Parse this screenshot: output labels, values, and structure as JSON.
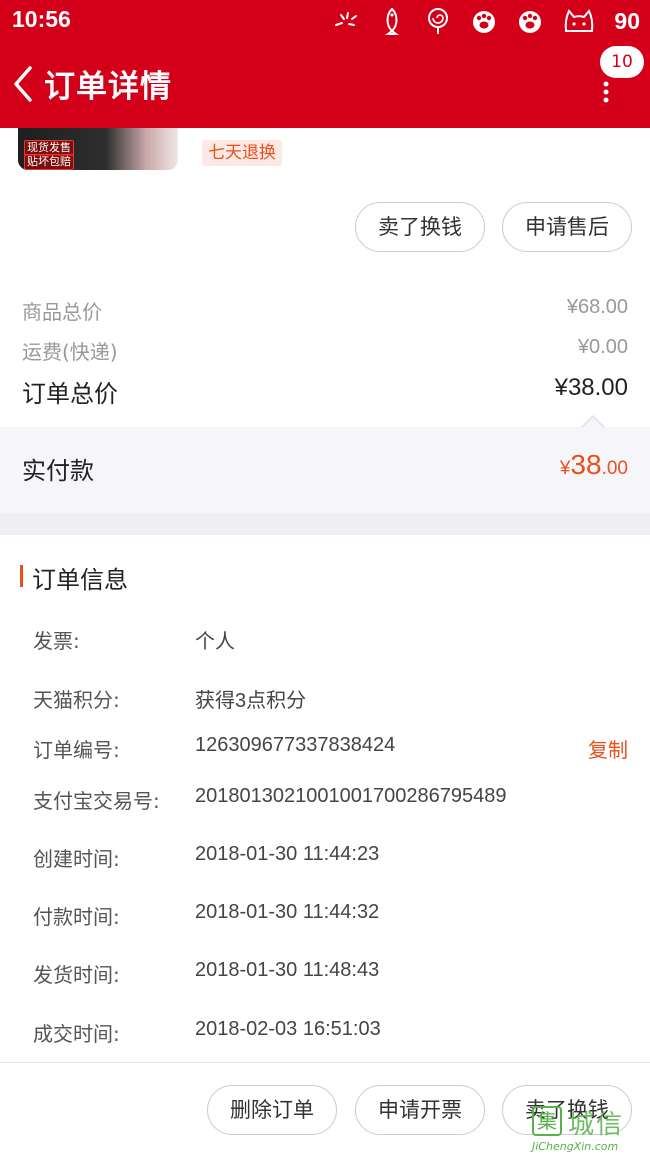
{
  "status_bar": {
    "time": "10:56",
    "battery": "90",
    "icons": [
      "notification-icon",
      "fish-icon",
      "lollipop-icon",
      "paw-icon",
      "paw-icon",
      "cat-icon"
    ]
  },
  "header": {
    "title": "订单详情",
    "badge_count": "10",
    "colors": {
      "brand": "#d4001a"
    }
  },
  "product": {
    "thumb_tags": [
      "现货发售",
      "贴坏包赔"
    ],
    "return_tag": "七天退换"
  },
  "actions_top": {
    "sell_label": "卖了换钱",
    "after_sale_label": "申请售后"
  },
  "price_summary": {
    "goods_total_label": "商品总价",
    "goods_total_value": "¥68.00",
    "shipping_label": "运费(快递)",
    "shipping_value": "¥0.00",
    "order_total_label": "订单总价",
    "order_total_value": "¥38.00",
    "paid_label": "实付款",
    "paid_symbol": "¥",
    "paid_int": "38",
    "paid_dec": ".00",
    "colors": {
      "accent": "#e8501e"
    }
  },
  "order_info": {
    "title": "订单信息",
    "copy_label": "复制",
    "rows": [
      {
        "label": "发票:",
        "value": "个人"
      },
      {
        "label": "天猫积分:",
        "value": "获得3点积分"
      },
      {
        "label": "订单编号:",
        "value": "126309677337838424"
      },
      {
        "label": "支付宝交易号:",
        "value": "2018013021001001700286795489"
      },
      {
        "label": "创建时间:",
        "value": "2018-01-30 11:44:23"
      },
      {
        "label": "付款时间:",
        "value": "2018-01-30 11:44:32"
      },
      {
        "label": "发货时间:",
        "value": "2018-01-30 11:48:43"
      },
      {
        "label": "成交时间:",
        "value": "2018-02-03 16:51:03"
      }
    ]
  },
  "bottom_bar": {
    "delete_label": "删除订单",
    "invoice_label": "申请开票",
    "sell_label": "卖了换钱"
  },
  "watermark": {
    "text": "城信",
    "url": "JiChengXin.com"
  }
}
